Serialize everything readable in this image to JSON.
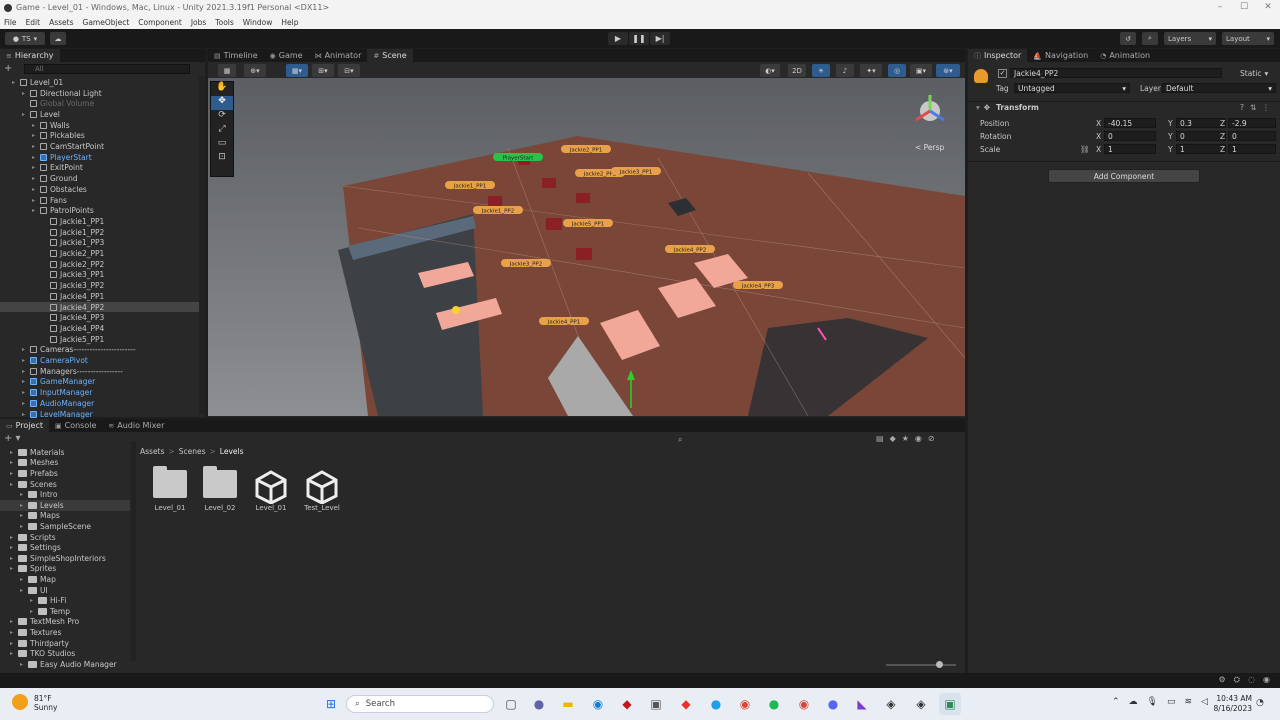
{
  "window": {
    "title": "Game - Level_01 - Windows, Mac, Linux - Unity 2021.3.19f1 Personal <DX11>"
  },
  "menu": [
    "File",
    "Edit",
    "Assets",
    "GameObject",
    "Component",
    "Jobs",
    "Tools",
    "Window",
    "Help"
  ],
  "toolbar": {
    "account": "TS",
    "layers": "Layers",
    "layout": "Layout"
  },
  "hierarchy": {
    "tab": "Hierarchy",
    "search_placeholder": "All",
    "items": [
      {
        "label": "Level_01",
        "depth": 0,
        "style": "scene"
      },
      {
        "label": "Directional Light",
        "depth": 1,
        "style": "normal"
      },
      {
        "label": "Global Volume",
        "depth": 1,
        "style": "faded"
      },
      {
        "label": "Level",
        "depth": 1,
        "style": "normal"
      },
      {
        "label": "Walls",
        "depth": 2,
        "style": "normal"
      },
      {
        "label": "Pickables",
        "depth": 2,
        "style": "normal"
      },
      {
        "label": "CamStartPoint",
        "depth": 2,
        "style": "normal"
      },
      {
        "label": "PlayerStart",
        "depth": 2,
        "style": "blue"
      },
      {
        "label": "ExitPoint",
        "depth": 2,
        "style": "normal"
      },
      {
        "label": "Ground",
        "depth": 2,
        "style": "normal"
      },
      {
        "label": "Obstacles",
        "depth": 2,
        "style": "normal"
      },
      {
        "label": "Fans",
        "depth": 2,
        "style": "normal"
      },
      {
        "label": "PatrolPoints",
        "depth": 2,
        "style": "normal"
      },
      {
        "label": "Jackie1_PP1",
        "depth": 3,
        "style": "normal"
      },
      {
        "label": "Jackie1_PP2",
        "depth": 3,
        "style": "normal"
      },
      {
        "label": "Jackie1_PP3",
        "depth": 3,
        "style": "normal"
      },
      {
        "label": "Jackie2_PP1",
        "depth": 3,
        "style": "normal"
      },
      {
        "label": "Jackie2_PP2",
        "depth": 3,
        "style": "normal"
      },
      {
        "label": "Jackie3_PP1",
        "depth": 3,
        "style": "normal"
      },
      {
        "label": "Jackie3_PP2",
        "depth": 3,
        "style": "normal"
      },
      {
        "label": "Jackie4_PP1",
        "depth": 3,
        "style": "normal"
      },
      {
        "label": "Jackie4_PP2",
        "depth": 3,
        "style": "selected"
      },
      {
        "label": "Jackie4_PP3",
        "depth": 3,
        "style": "normal"
      },
      {
        "label": "Jackie4_PP4",
        "depth": 3,
        "style": "normal"
      },
      {
        "label": "Jackie5_PP1",
        "depth": 3,
        "style": "normal"
      },
      {
        "label": "Cameras-----------------------",
        "depth": 1,
        "style": "normal"
      },
      {
        "label": "CameraPivot",
        "depth": 1,
        "style": "blue"
      },
      {
        "label": "Managers-----------------",
        "depth": 1,
        "style": "normal"
      },
      {
        "label": "GameManager",
        "depth": 1,
        "style": "blue"
      },
      {
        "label": "InputManager",
        "depth": 1,
        "style": "blue"
      },
      {
        "label": "AudioManager",
        "depth": 1,
        "style": "blue"
      },
      {
        "label": "LevelManager",
        "depth": 1,
        "style": "blue"
      }
    ]
  },
  "center_tabs": [
    "Timeline",
    "Game",
    "Animator",
    "Scene"
  ],
  "scene": {
    "persp_label": "< Persp",
    "mode_2d": "2D",
    "labels": [
      "Jackie1_PP1",
      "Jackie1_PP2",
      "Jackie2_PP1",
      "Jackie2_PP2",
      "Jackie3_PP1",
      "Jackie3_PP2",
      "Jackie4_PP1",
      "Jackie4_PP2",
      "Jackie4_PP3",
      "Jackie5_PP1",
      "PlayerStart"
    ]
  },
  "inspector": {
    "tabs": [
      "Inspector",
      "Navigation",
      "Animation"
    ],
    "object_name": "Jackie4_PP2",
    "static_label": "Static",
    "tag_label": "Tag",
    "tag_value": "Untagged",
    "layer_label": "Layer",
    "layer_value": "Default",
    "component": "Transform",
    "position_label": "Position",
    "rotation_label": "Rotation",
    "scale_label": "Scale",
    "position": {
      "x": "-40.15",
      "y": "0.3",
      "z": "-2.9"
    },
    "rotation": {
      "x": "0",
      "y": "0",
      "z": "0"
    },
    "scale": {
      "x": "1",
      "y": "1",
      "z": "1"
    },
    "add_component": "Add Component"
  },
  "bottom_tabs": [
    "Project",
    "Console",
    "Audio Mixer"
  ],
  "project": {
    "breadcrumb": [
      "Assets",
      "Scenes",
      "Levels"
    ],
    "tree": [
      {
        "label": "Materials",
        "depth": 1
      },
      {
        "label": "Meshes",
        "depth": 1
      },
      {
        "label": "Prefabs",
        "depth": 1
      },
      {
        "label": "Scenes",
        "depth": 1
      },
      {
        "label": "Intro",
        "depth": 2
      },
      {
        "label": "Levels",
        "depth": 2
      },
      {
        "label": "Maps",
        "depth": 2
      },
      {
        "label": "SampleScene",
        "depth": 2
      },
      {
        "label": "Scripts",
        "depth": 1
      },
      {
        "label": "Settings",
        "depth": 1
      },
      {
        "label": "SimpleShopInteriors",
        "depth": 1
      },
      {
        "label": "Sprites",
        "depth": 1
      },
      {
        "label": "Map",
        "depth": 2
      },
      {
        "label": "UI",
        "depth": 2
      },
      {
        "label": "Hi-Fi",
        "depth": 3
      },
      {
        "label": "Temp",
        "depth": 3
      },
      {
        "label": "TextMesh Pro",
        "depth": 1
      },
      {
        "label": "Textures",
        "depth": 1
      },
      {
        "label": "Thirdparty",
        "depth": 1
      },
      {
        "label": "TKO Studios",
        "depth": 1
      },
      {
        "label": "Easy Audio Manager",
        "depth": 2
      }
    ],
    "assets": [
      {
        "label": "Level_01",
        "kind": "folder"
      },
      {
        "label": "Level_02",
        "kind": "folder"
      },
      {
        "label": "Level_01",
        "kind": "scene"
      },
      {
        "label": "Test_Level",
        "kind": "scene"
      }
    ]
  },
  "taskbar": {
    "weather_temp": "81°F",
    "weather_desc": "Sunny",
    "search": "Search",
    "time": "10:43 AM",
    "date": "8/16/2023"
  },
  "colors": {
    "accent_blue": "#6cb2ff",
    "selection": "#444444",
    "label_orange": "#e8a04a",
    "floor": "#7a4638"
  }
}
